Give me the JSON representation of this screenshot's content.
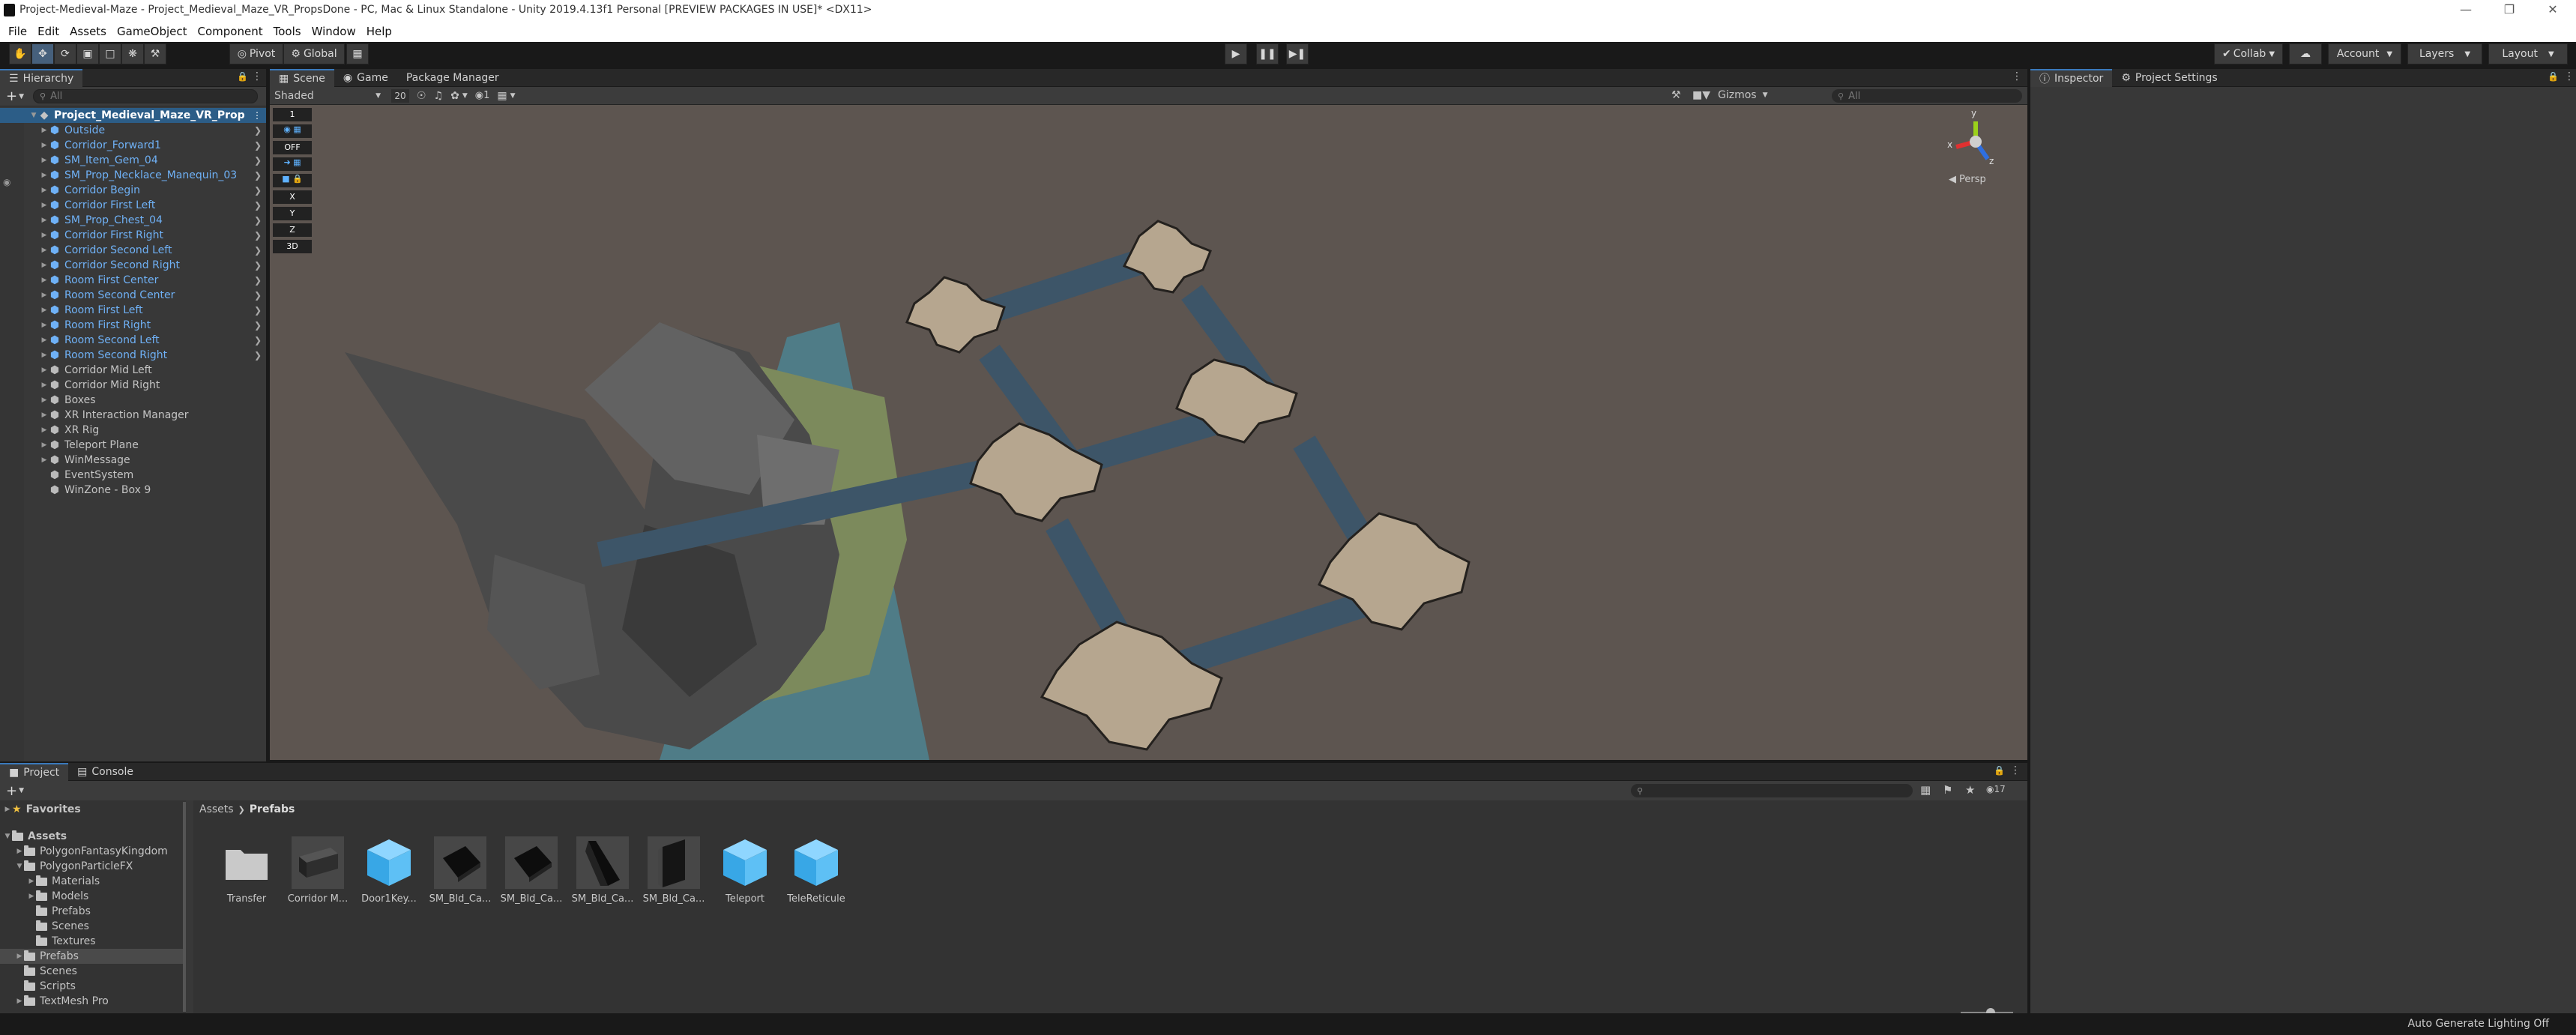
{
  "window": {
    "title": "Project-Medieval-Maze - Project_Medieval_Maze_VR_PropsDone - PC, Mac & Linux Standalone - Unity 2019.4.13f1 Personal [PREVIEW PACKAGES IN USE]* <DX11>"
  },
  "menubar": [
    "File",
    "Edit",
    "Assets",
    "GameObject",
    "Component",
    "Tools",
    "Window",
    "Help"
  ],
  "toolbar": {
    "pivot_label": "Pivot",
    "global_label": "Global",
    "collab_label": "Collab",
    "account_label": "Account",
    "layers_label": "Layers",
    "layout_label": "Layout"
  },
  "hierarchy": {
    "tab_label": "Hierarchy",
    "search_placeholder": "All",
    "scene_name": "Project_Medieval_Maze_VR_Prop",
    "items": [
      {
        "label": "Outside",
        "prefab": true
      },
      {
        "label": "Corridor_Forward1",
        "prefab": true
      },
      {
        "label": "SM_Item_Gem_04",
        "prefab": true
      },
      {
        "label": "SM_Prop_Necklace_Manequin_03",
        "prefab": true
      },
      {
        "label": "Corridor Begin",
        "prefab": true
      },
      {
        "label": "Corridor First Left",
        "prefab": true
      },
      {
        "label": "SM_Prop_Chest_04",
        "prefab": true
      },
      {
        "label": "Corridor First Right",
        "prefab": true
      },
      {
        "label": "Corridor Second Left",
        "prefab": true
      },
      {
        "label": "Corridor Second Right",
        "prefab": true
      },
      {
        "label": "Room First Center",
        "prefab": true
      },
      {
        "label": "Room Second Center",
        "prefab": true
      },
      {
        "label": "Room First Left",
        "prefab": true
      },
      {
        "label": "Room First Right",
        "prefab": true
      },
      {
        "label": "Room Second Left",
        "prefab": true
      },
      {
        "label": "Room Second Right",
        "prefab": true
      },
      {
        "label": "Corridor Mid Left",
        "prefab": false
      },
      {
        "label": "Corridor Mid Right",
        "prefab": false
      },
      {
        "label": "Boxes",
        "prefab": false
      },
      {
        "label": "XR Interaction Manager",
        "prefab": false
      },
      {
        "label": "XR Rig",
        "prefab": false
      },
      {
        "label": "Teleport Plane",
        "prefab": false
      },
      {
        "label": "WinMessage",
        "prefab": false
      },
      {
        "label": "EventSystem",
        "prefab": false
      },
      {
        "label": "WinZone - Box 9",
        "prefab": false
      }
    ]
  },
  "scene": {
    "tabs": [
      "Scene",
      "Game",
      "Package Manager"
    ],
    "shading_mode": "Shaded",
    "grid_size": "20",
    "layer_count": "1",
    "gizmos_label": "Gizmos",
    "search_placeholder": "All",
    "persp_label": "Persp",
    "axis_x": "x",
    "axis_y": "y",
    "axis_z": "z",
    "overlay_labels": [
      "1",
      "OFF",
      "X",
      "Y",
      "Z",
      "3D"
    ]
  },
  "inspector": {
    "tabs": [
      "Inspector",
      "Project Settings"
    ]
  },
  "project": {
    "tabs": [
      "Project",
      "Console"
    ],
    "favorites_label": "Favorites",
    "breadcrumb": [
      "Assets",
      "Prefabs"
    ],
    "hidden_count": "17",
    "tree": [
      {
        "label": "Assets",
        "depth": 0,
        "expanded": true
      },
      {
        "label": "PolygonFantasyKingdom",
        "depth": 1,
        "expanded": false
      },
      {
        "label": "PolygonParticleFX",
        "depth": 1,
        "expanded": true
      },
      {
        "label": "Materials",
        "depth": 2,
        "expanded": false
      },
      {
        "label": "Models",
        "depth": 2,
        "expanded": false
      },
      {
        "label": "Prefabs",
        "depth": 2,
        "expanded": null
      },
      {
        "label": "Scenes",
        "depth": 2,
        "expanded": null
      },
      {
        "label": "Textures",
        "depth": 2,
        "expanded": null
      },
      {
        "label": "Prefabs",
        "depth": 1,
        "expanded": false,
        "selected": true
      },
      {
        "label": "Scenes",
        "depth": 1,
        "expanded": null
      },
      {
        "label": "Scripts",
        "depth": 1,
        "expanded": null
      },
      {
        "label": "TextMesh Pro",
        "depth": 1,
        "expanded": false
      }
    ],
    "assets": [
      {
        "name": "Transfer",
        "kind": "folder-icon"
      },
      {
        "name": "Corridor M...",
        "kind": "corridor-icon"
      },
      {
        "name": "Door1Key...",
        "kind": "cube-icon"
      },
      {
        "name": "SM_Bld_Ca...",
        "kind": "block-icon"
      },
      {
        "name": "SM_Bld_Ca...",
        "kind": "block-icon"
      },
      {
        "name": "SM_Bld_Ca...",
        "kind": "wedge-icon"
      },
      {
        "name": "SM_Bld_Ca...",
        "kind": "wall-icon"
      },
      {
        "name": "Teleport",
        "kind": "cube-icon"
      },
      {
        "name": "TeleReticule",
        "kind": "cube-icon"
      }
    ]
  },
  "status": {
    "lighting_label": "Auto Generate Lighting Off"
  }
}
